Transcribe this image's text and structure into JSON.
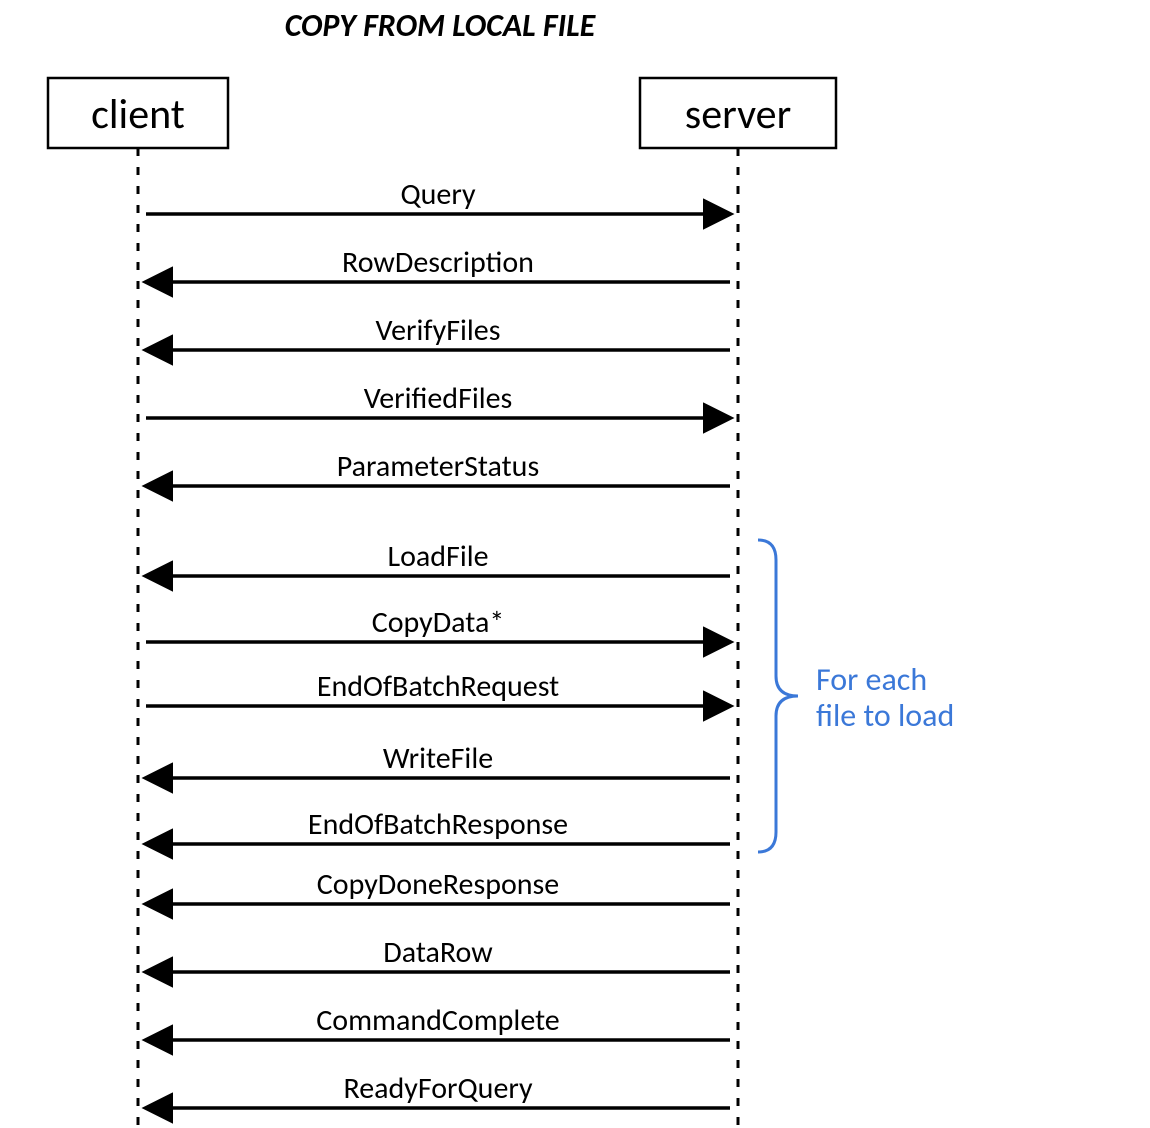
{
  "title": "COPY FROM LOCAL FILE",
  "actors": {
    "left": "client",
    "right": "server"
  },
  "messages": [
    {
      "label": "Query",
      "dir": "right"
    },
    {
      "label": "RowDescription",
      "dir": "left"
    },
    {
      "label": "VerifyFiles",
      "dir": "left"
    },
    {
      "label": "VerifiedFiles",
      "dir": "right"
    },
    {
      "label": "ParameterStatus",
      "dir": "left"
    },
    {
      "label": "LoadFile",
      "dir": "left"
    },
    {
      "label": "CopyData*",
      "dir": "right"
    },
    {
      "label": "EndOfBatchRequest",
      "dir": "right"
    },
    {
      "label": "WriteFile",
      "dir": "left"
    },
    {
      "label": "EndOfBatchResponse",
      "dir": "left"
    },
    {
      "label": "CopyDoneResponse",
      "dir": "left"
    },
    {
      "label": "DataRow",
      "dir": "left"
    },
    {
      "label": "CommandComplete",
      "dir": "left"
    },
    {
      "label": "ReadyForQuery",
      "dir": "left"
    }
  ],
  "group": {
    "start": 5,
    "end": 9,
    "labelLines": [
      "For each",
      "file to load"
    ]
  },
  "colors": {
    "accent": "#3b78d8"
  }
}
